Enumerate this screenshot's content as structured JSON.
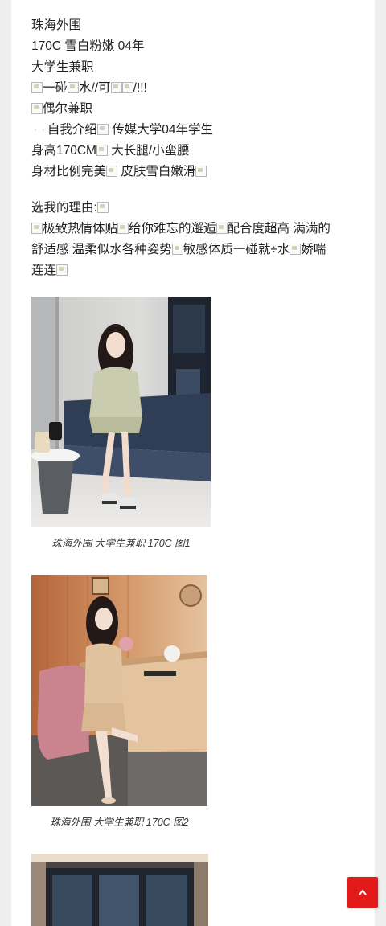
{
  "article": {
    "lines": [
      "珠海外围",
      "170C  雪白粉嫩 04年",
      "大学生兼职"
    ],
    "line4": {
      "t1": "一碰",
      "t2": "水//可",
      "t3": "/!!!"
    },
    "line5": {
      "t1": "偶尔兼职"
    },
    "line6": {
      "prefix": "▫️▫️",
      "t1": "自我介绍",
      "t2": " 传媒大学04年学生"
    },
    "line7": {
      "t1": "身高170CM",
      "t2": " 大长腿/小蛮腰"
    },
    "line8": {
      "t1": "身材比例完美",
      "t2": " 皮肤雪白嫩滑"
    },
    "reason_title": "选我的理由:",
    "reasons": {
      "t1": "极致热情体贴",
      "t2": "给你难忘的邂逅",
      "t3": "配合度超高  满满的舒适感  温柔似水各种姿势",
      "t4": "敏感体质一碰就÷水",
      "t5": "娇喘连连"
    }
  },
  "figures": [
    {
      "caption": "珠海外围 大学生兼职 170C 图1"
    },
    {
      "caption": "珠海外围 大学生兼职 170C 图2"
    }
  ],
  "back_to_top": {
    "icon": "chevron-up-icon",
    "color": "#e21a1a"
  }
}
